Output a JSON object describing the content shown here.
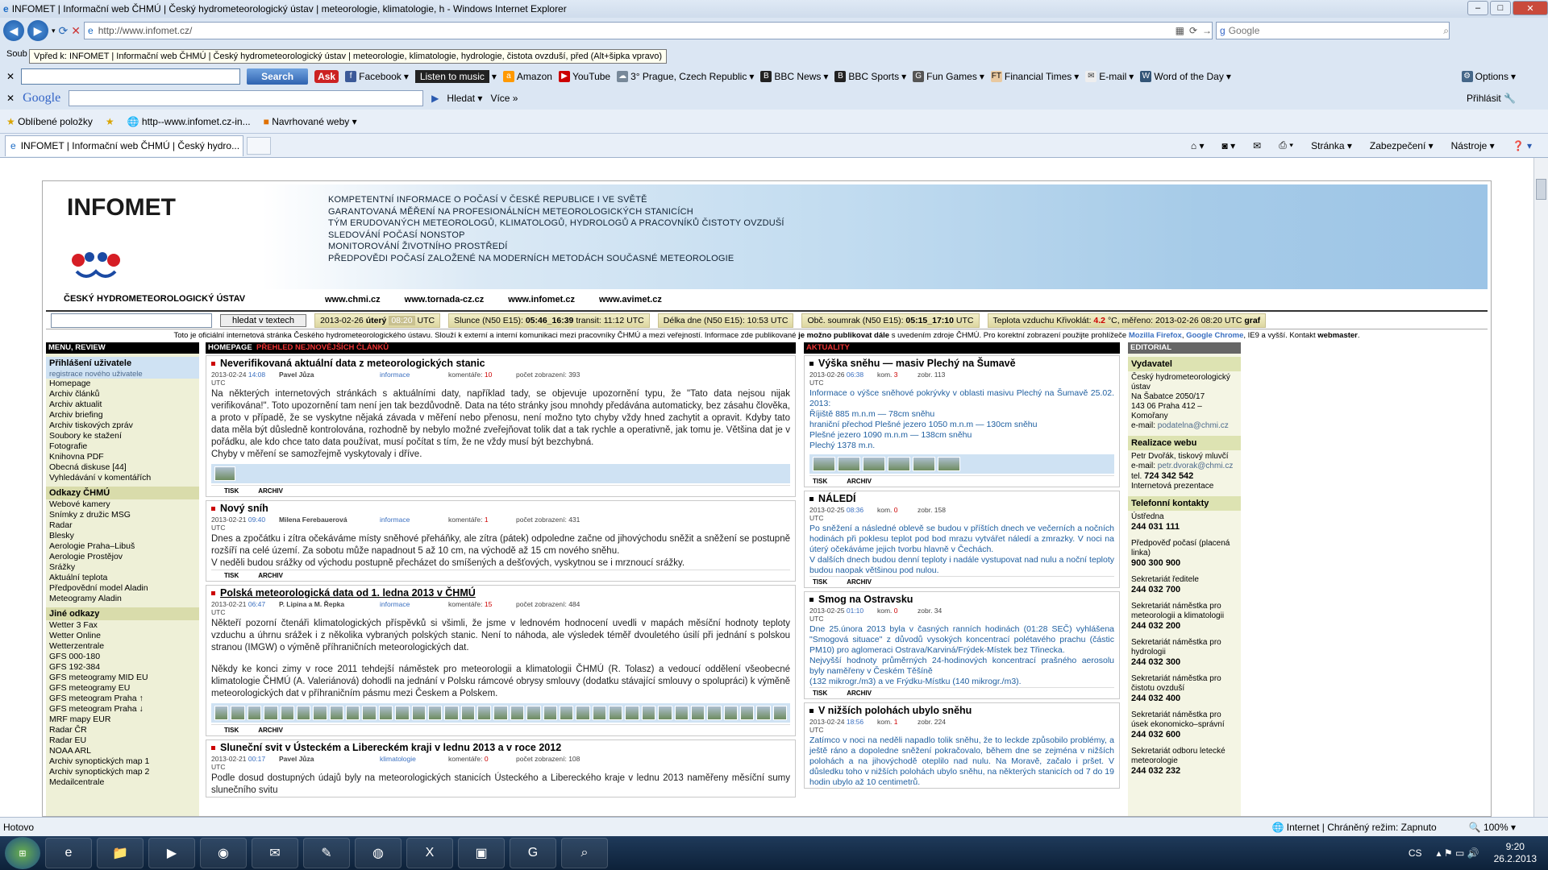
{
  "window": {
    "title": "INFOMET | Informační web ČHMÚ | Český hydrometeorologický ústav | meteorologie, klimatologie, h - Windows Internet Explorer"
  },
  "address": {
    "url": "http://www.infomet.cz/",
    "search_placeholder": "Google"
  },
  "tooltip": "Vpřed k: INFOMET | Informační web ČHMÚ | Český hydrometeorologický ústav | meteorologie, klimatologie, hydrologie, čistota ovzduší, před (Alt+šipka vpravo)",
  "menu_soubor": "Soub",
  "askbar": {
    "search_label": "Search",
    "items": [
      "Facebook",
      "Listen to music",
      "Amazon",
      "YouTube",
      "3° Prague, Czech Republic",
      "BBC News",
      "BBC Sports",
      "Fun Games",
      "Financial Times",
      "E-mail",
      "Word of the Day"
    ],
    "options": "Options"
  },
  "googlebar": {
    "logo": "Google",
    "hledat": "Hledat",
    "vice": "Více",
    "prihlasit": "Přihlásit"
  },
  "favbar": {
    "oblibene": "Oblíbené položky",
    "link1": "http--www.infomet.cz-in...",
    "navrhovane": "Navrhované weby"
  },
  "tab": {
    "label": "INFOMET | Informační web ČHMÚ | Český hydro...",
    "tools": [
      "Stránka",
      "Zabezpečení",
      "Nástroje"
    ]
  },
  "status": {
    "left": "Hotovo",
    "zone": "Internet | Chráněný režim: Zapnuto",
    "zoom": "100%"
  },
  "taskbar": {
    "lang": "CS",
    "time": "9:20",
    "date": "26.2.2013"
  },
  "site": {
    "brand": "INFOMET",
    "ustav": "ČESKÝ HYDROMETEOROLOGICKÝ ÚSTAV",
    "mission": [
      "KOMPETENTNÍ INFORMACE O POČASÍ V ČESKÉ REPUBLICE I VE SVĚTĚ",
      "GARANTOVANÁ MĚŘENÍ NA PROFESIONÁLNÍCH METEOROLOGICKÝCH STANICÍCH",
      "TÝM ERUDOVANÝCH METEOROLOGŮ, KLIMATOLOGŮ, HYDROLOGŮ A PRACOVNÍKŮ ČISTOTY OVZDUŠÍ",
      "SLEDOVÁNÍ POČASÍ NONSTOP",
      "MONITOROVÁNÍ ŽIVOTNÍHO PROSTŘEDÍ",
      "PŘEDPOVĚDI POČASÍ ZALOŽENÉ NA MODERNÍCH METODÁCH SOUČASNÉ METEOROLOGIE"
    ],
    "sites": [
      "www.chmi.cz",
      "www.tornada-cz.cz",
      "www.infomet.cz",
      "www.avimet.cz"
    ],
    "search_btn": "hledat v textech",
    "date": "2013-02-26",
    "day": "úterý",
    "time": "08:20",
    "utc": "UTC",
    "slunce": "Slunce (N50 E15):",
    "slunce_val": "05:46_16:39",
    "transit": "transit:",
    "transit_val": "11:12",
    "delka": "Délka dne (N50 E15): 10:53",
    "soumrak": "Obč. soumrak (N50 E15):",
    "soumrak_val": "05:15_17:10",
    "teplota": "Teplota vzduchu Křivoklát:",
    "teplota_val": "4.2",
    "teplota_unit": "°C, měřeno:",
    "teplota_time": "2013-02-26 08:20",
    "graf": "graf",
    "note1": "Toto je oficiální internetová stránka Českého hydrometeorologického ústavu. Slouží k externí a interní komunikaci mezi pracovníky ČHMÚ a mezi veřejností. Informace zde publikované ",
    "note_b": "je možno publikovat dále",
    "note2": " s uvedením zdroje ČHMÚ. Pro korektní zobrazení použijte prohlížeče ",
    "note_ff": "Mozilla Firefox",
    "note_gc": "Google Chrome",
    "note3": ", IE9 a vyšší. Kontakt ",
    "note_wm": "webmaster",
    "hdr_menu": "MENU, REVIEW",
    "hdr_home": "HOMEPAGE",
    "hdr_prehled": "PŘEHLED NEJNOVĚJŠÍCH ČLÁNKŮ",
    "hdr_aktuality": "AKTUALITY",
    "hdr_editorial": "EDITORIAL"
  },
  "left": {
    "login": "Přihlášení uživatele",
    "register": "registrace nového uživatele",
    "items": [
      "Homepage",
      "Archiv článků",
      "Archiv aktualit",
      "Archiv briefing",
      "Archiv tiskových zpráv",
      "Soubory ke stažení",
      "Fotografie",
      "Knihovna PDF",
      "Obecná diskuse [44]",
      "Vyhledávání v komentářích"
    ],
    "odkazy_head": "Odkazy ČHMÚ",
    "odkazy": [
      "Webové kamery",
      "Snímky z družic MSG",
      "Radar",
      "Blesky",
      "Aerologie Praha–Libuš",
      "Aerologie Prostějov",
      "Srážky",
      "Aktuální teplota",
      "Předpovědní model Aladin",
      "Meteogramy Aladin"
    ],
    "jine_head": "Jiné odkazy",
    "jine": [
      "Wetter 3 Fax",
      "Wetter Online",
      "Wetterzentrale",
      "GFS 000-180",
      "GFS 192-384",
      "GFS meteogramy MID EU",
      "GFS meteogramy EU",
      "GFS meteogram Praha ↑",
      "GFS meteogram Praha ↓",
      "MRF mapy EUR",
      "Radar ČR",
      "Radar EU",
      "NOAA ARL",
      "Archiv synoptických map 1",
      "Archiv synoptických map 2",
      "Medailcentrale"
    ]
  },
  "articles": [
    {
      "title": "Neverifikovaná aktuální data z meteorologických stanic",
      "date": "2013-02-24",
      "time": "14:08",
      "author": "Pavel Jůza",
      "cat": "informace",
      "kom": "komentáře:",
      "kom_n": "10",
      "poc": "počet zobrazení: 393",
      "body": "Na některých internetových stránkách s aktuálními daty, například tady, se objevuje upozornění typu, že \"Tato data nejsou nijak verifikována!\". Toto upozornění tam není jen tak bezdůvodně. Data na této stránky jsou mnohdy předávána automaticky, bez zásahu člověka, a proto v případě, že se vyskytne nějaká závada v měření nebo přenosu, není možno tyto chyby vždy hned zachytit a opravit. Kdyby tato data měla být důsledně kontrolována, rozhodně by nebylo možné zveřejňovat tolik dat a tak rychle a operativně, jak tomu je. Většina dat je v pořádku, ale kdo chce tato data používat, musí počítat s tím, že ne vždy musí být bezchybná.",
      "body2": "Chyby v měření se samozřejmě vyskytovaly i dříve.",
      "tisk": "TISK",
      "archiv": "ARCHIV"
    },
    {
      "title": "Nový sníh",
      "date": "2013-02-21",
      "time": "09:40",
      "author": "Milena Ferebauerová",
      "cat": "informace",
      "kom": "komentáře:",
      "kom_n": "1",
      "poc": "počet zobrazení: 431",
      "body": "Dnes a zpočátku i zítra očekáváme místy sněhové přeháňky, ale zítra (pátek) odpoledne začne od jihovýchodu sněžit a sněžení se postupně rozšíří na celé území. Za sobotu může napadnout 5 až 10 cm, na východě až 15 cm nového sněhu.",
      "body2": "V neděli budou srážky od východu postupně přecházet do smíšených a dešťových, vyskytnou se i mrznoucí srážky.",
      "tisk": "TISK",
      "archiv": "ARCHIV"
    },
    {
      "title": "Polská meteorologická data od 1. ledna 2013 v ČHMÚ",
      "date": "2013-02-21",
      "time": "06:47",
      "author": "P. Lipina a M. Řepka",
      "cat": "informace",
      "kom": "komentáře:",
      "kom_n": "15",
      "poc": "počet zobrazení: 484",
      "body": "Někteří pozorní čtenáři klimatologických příspěvků si všimli, že jsme v lednovém hodnocení uvedli v mapách měsíční hodnoty teploty vzduchu a úhrnu srážek i z několika vybraných polských stanic. Není to náhoda, ale výsledek téměř dvouletého úsilí při jednání s polskou stranou (IMGW) o výměně příhraničních meteorologických dat.",
      "body2": "Někdy ke konci zimy v roce 2011 tehdejší náměstek pro meteorologii a klimatologii ČHMÚ (R. Tolasz) a vedoucí oddělení všeobecné klimatologie ČHMÚ (A. Valeriánová) dohodli na jednání v Polsku rámcové obrysy smlouvy (dodatku stávající smlouvy o spolupráci) k výměně meteorologických dat v příhraničním pásmu mezi Českem a Polskem.",
      "tisk": "TISK",
      "archiv": "ARCHIV"
    },
    {
      "title": "Sluneční svit v Ústeckém a Libereckém kraji v lednu 2013 a v roce 2012",
      "date": "2013-02-21",
      "time": "00:17",
      "author": "Pavel Jůza",
      "cat": "klimatologie",
      "kom": "komentáře:",
      "kom_n": "0",
      "poc": "počet zobrazení: 108",
      "body": "Podle dosud dostupných údajů byly na meteorologických stanicích Ústeckého a Libereckého kraje v lednu 2013 naměřeny měsíční sumy slunečního svitu"
    }
  ],
  "aktuality": [
    {
      "title": "Výška sněhu — masiv Plechý na Šumavě",
      "date": "2013-02-26",
      "time": "06:38",
      "kom": "kom.",
      "kom_n": "3",
      "zobr": "zobr. 113",
      "body": [
        "Informace o výšce sněhové pokrývky v oblasti masivu Plechý na Šumavě 25.02. 2013:",
        "",
        "Říjiště 885 m.n.m — 78cm sněhu",
        "hraniční přechod Plešné jezero 1050 m.n.m — 130cm sněhu",
        "Plešné jezero 1090 m.n.m — 138cm sněhu",
        "Plechý 1378 m.n."
      ],
      "tisk": "TISK",
      "archiv": "ARCHIV"
    },
    {
      "title": "NÁLEDÍ",
      "date": "2013-02-25",
      "time": "08:36",
      "kom": "kom.",
      "kom_n": "0",
      "zobr": "zobr. 158",
      "body": [
        "Po sněžení a následné oblevě se budou v příštích dnech ve večerních a nočních hodinách při poklesu teplot pod bod mrazu vytvářet náledí a zmrazky. V noci na úterý očekáváme jejich tvorbu hlavně v Čechách.",
        "V dalších dnech budou denní teploty i nadále vystupovat nad nulu a noční teploty budou naopak většinou pod nulou."
      ],
      "tisk": "TISK",
      "archiv": "ARCHIV"
    },
    {
      "title": "Smog na Ostravsku",
      "date": "2013-02-25",
      "time": "01:10",
      "kom": "kom.",
      "kom_n": "0",
      "zobr": "zobr. 34",
      "body": [
        "Dne 25.února 2013 byla v časných ranních hodinách (01:28 SEČ) vyhlášena \"Smogová situace\" z důvodů vysokých koncentrací polétavého prachu (částic PM10) pro aglomeraci Ostrava/Karviná/Frýdek-Místek bez Třinecka.",
        "Nejvyšší hodnoty průměrných 24-hodinových koncentrací prašného aerosolu byly naměřeny v Českém Těšíně",
        "(132 mikrogr./m3) a ve Frýdku-Místku (140 mikrogr./m3)."
      ],
      "tisk": "TISK",
      "archiv": "ARCHIV"
    },
    {
      "title": "V nižších polohách ubylo sněhu",
      "date": "2013-02-24",
      "time": "18:56",
      "kom": "kom.",
      "kom_n": "1",
      "zobr": "zobr. 224",
      "body": [
        "Zatímco v noci na neděli napadlo tolik sněhu, že to leckde způsobilo problémy, a ještě ráno a dopoledne sněžení pokračovalo, během dne se zejména v nižších polohách a na jihovýchodě oteplilo nad nulu. Na Moravě, začalo i pršet. V důsledku toho v nižších polohách ubylo sněhu, na některých stanicích od 7 do 19 hodin ubylo až 10 centimetrů."
      ]
    }
  ],
  "editorial": {
    "vydavatel_head": "Vydavatel",
    "vydavatel": [
      "Český hydrometeorologický ústav",
      "Na Šabatce 2050/17",
      "143 06 Praha 412 – Komořany",
      "e-mail:"
    ],
    "vydavatel_mail": "podatelna@chmi.cz",
    "realizace_head": "Realizace webu",
    "realizace": [
      "Petr Dvořák, tiskový mluvčí",
      "e-mail:"
    ],
    "realizace_mail": "petr.dvorak@chmi.cz",
    "tel_label": "tel.",
    "tel": "724 342 542",
    "prezentace": "Internetová prezentace",
    "kontakty_head": "Telefonní kontakty",
    "kontakty": [
      {
        "label": "Ústředna",
        "num": "244 031 111"
      },
      {
        "label": "Předpověď počasí (placená linka)",
        "num": "900 300 900"
      },
      {
        "label": "Sekretariát ředitele",
        "num": "244 032 700"
      },
      {
        "label": "Sekretariát náměstka pro meteorologii a klimatologii",
        "num": "244 032 200"
      },
      {
        "label": "Sekretariát náměstka pro hydrologii",
        "num": "244 032 300"
      },
      {
        "label": "Sekretariát náměstka pro čistotu ovzduší",
        "num": "244 032 400"
      },
      {
        "label": "Sekretariát náměstka pro úsek ekonomicko–správní",
        "num": "244 032 600"
      },
      {
        "label": "Sekretariát odboru letecké meteorologie",
        "num": "244 032 232"
      }
    ]
  }
}
